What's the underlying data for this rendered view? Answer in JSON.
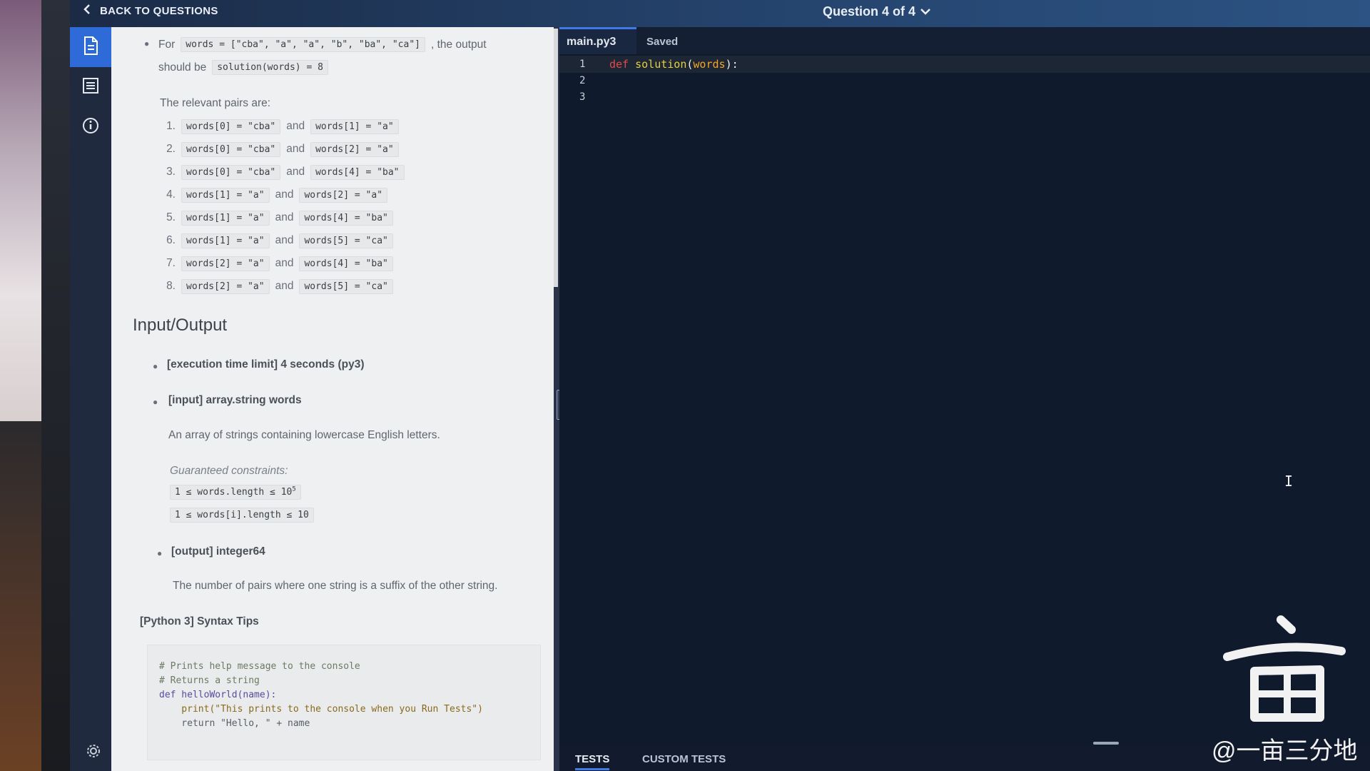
{
  "topbar": {
    "back_label": "BACK TO QUESTIONS",
    "question_nav": "Question 4 of 4"
  },
  "description": {
    "example": {
      "prefix": "For",
      "words_code": "words = [\"cba\", \"a\", \"a\", \"b\", \"ba\", \"ca\"]",
      "output_text": ", the output",
      "should_be": "should be",
      "solution_code": "solution(words) = 8"
    },
    "relevant_pairs_label": "The relevant pairs are:",
    "pairs": [
      {
        "num": "1.",
        "left": "words[0] = \"cba\"",
        "and": "and",
        "right": "words[1] = \"a\""
      },
      {
        "num": "2.",
        "left": "words[0] = \"cba\"",
        "and": "and",
        "right": "words[2] = \"a\""
      },
      {
        "num": "3.",
        "left": "words[0] = \"cba\"",
        "and": "and",
        "right": "words[4] = \"ba\""
      },
      {
        "num": "4.",
        "left": "words[1] = \"a\"",
        "and": "and",
        "right": "words[2] = \"a\""
      },
      {
        "num": "5.",
        "left": "words[1] = \"a\"",
        "and": "and",
        "right": "words[4] = \"ba\""
      },
      {
        "num": "6.",
        "left": "words[1] = \"a\"",
        "and": "and",
        "right": "words[5] = \"ca\""
      },
      {
        "num": "7.",
        "left": "words[2] = \"a\"",
        "and": "and",
        "right": "words[4] = \"ba\""
      },
      {
        "num": "8.",
        "left": "words[2] = \"a\"",
        "and": "and",
        "right": "words[5] = \"ca\""
      }
    ],
    "io_heading": "Input/Output",
    "exec_limit": "[execution time limit] 4 seconds (py3)",
    "input_label": "[input] array.string words",
    "input_desc": "An array of strings containing lowercase English letters.",
    "constraints_label": "Guaranteed constraints:",
    "constraint1": "1 ≤ words.length ≤ 10",
    "constraint1_sup": "5",
    "constraint2": "1 ≤ words[i].length ≤ 10",
    "output_label": "[output] integer64",
    "output_desc": "The number of pairs where one string is a suffix of the other string.",
    "syntax_tips": "[Python 3] Syntax Tips",
    "syntax_code": {
      "c1": "# Prints help message to the console",
      "c2": "# Returns a string",
      "d1": "def helloWorld(name):",
      "p1": "    print(\"This prints to the console when you Run Tests\")",
      "r1": "    return \"Hello, \" + name"
    }
  },
  "editor": {
    "filename": "main.py3",
    "status": "Saved",
    "line_numbers": [
      "1",
      "2",
      "3"
    ],
    "code_line1": {
      "kw": "def",
      "fn": "solution",
      "open": "(",
      "param": "words",
      "close": "):"
    },
    "bottom_tabs": [
      "TESTS",
      "CUSTOM TESTS"
    ]
  },
  "watermark": "@一亩三分地"
}
